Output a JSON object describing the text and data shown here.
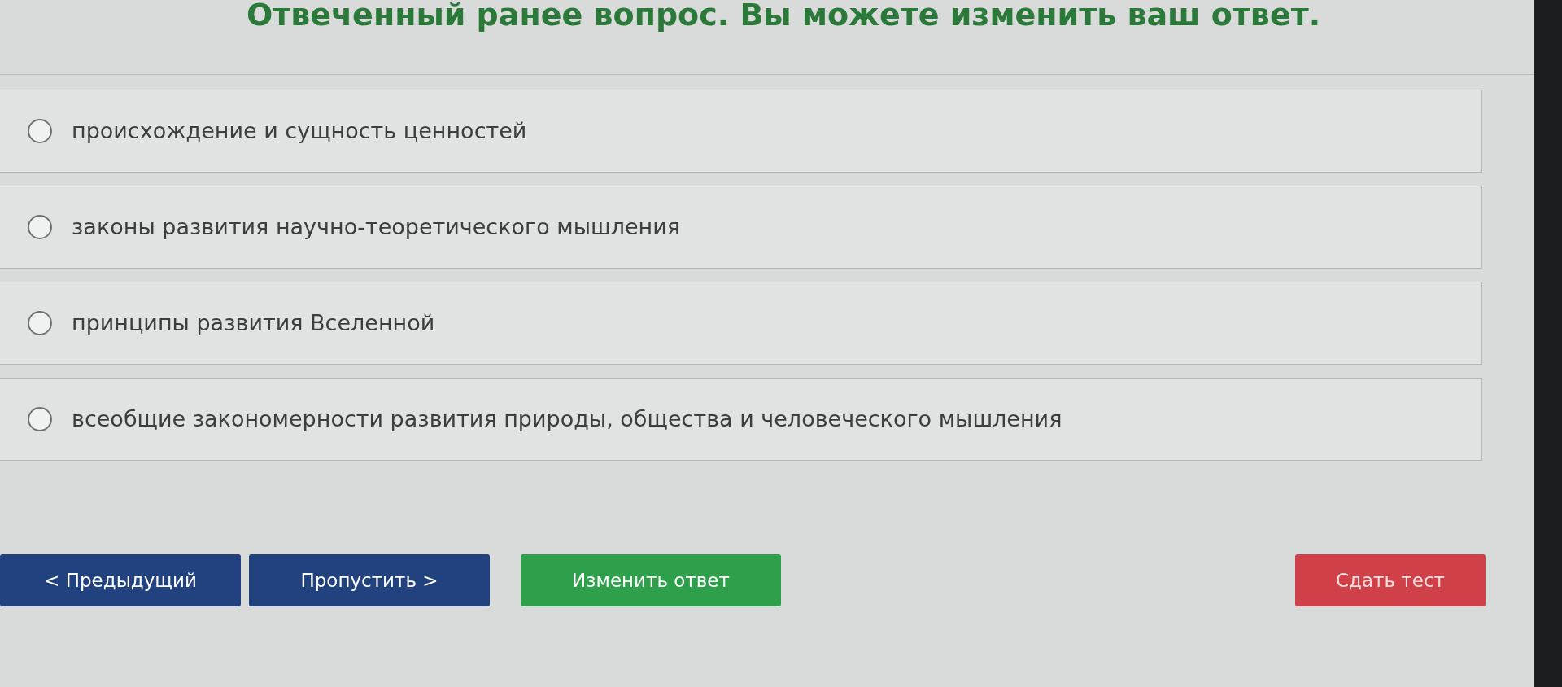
{
  "heading": "Отвеченный ранее вопрос. Вы можете изменить ваш ответ.",
  "options": [
    {
      "label": "происхождение и сущность ценностей",
      "selected": false
    },
    {
      "label": "законы развития научно-теоретического мышления",
      "selected": false
    },
    {
      "label": "принципы развития Вселенной",
      "selected": false
    },
    {
      "label": "всеобщие закономерности развития природы, общества и человеческого мышления",
      "selected": false
    }
  ],
  "buttons": [
    {
      "kind": "nav",
      "label": "< Предыдущий"
    },
    {
      "kind": "nav",
      "label": "Пропустить >"
    },
    {
      "kind": "confirm",
      "label": "Изменить ответ"
    },
    {
      "kind": "finish",
      "label": "Сдать тест"
    }
  ]
}
